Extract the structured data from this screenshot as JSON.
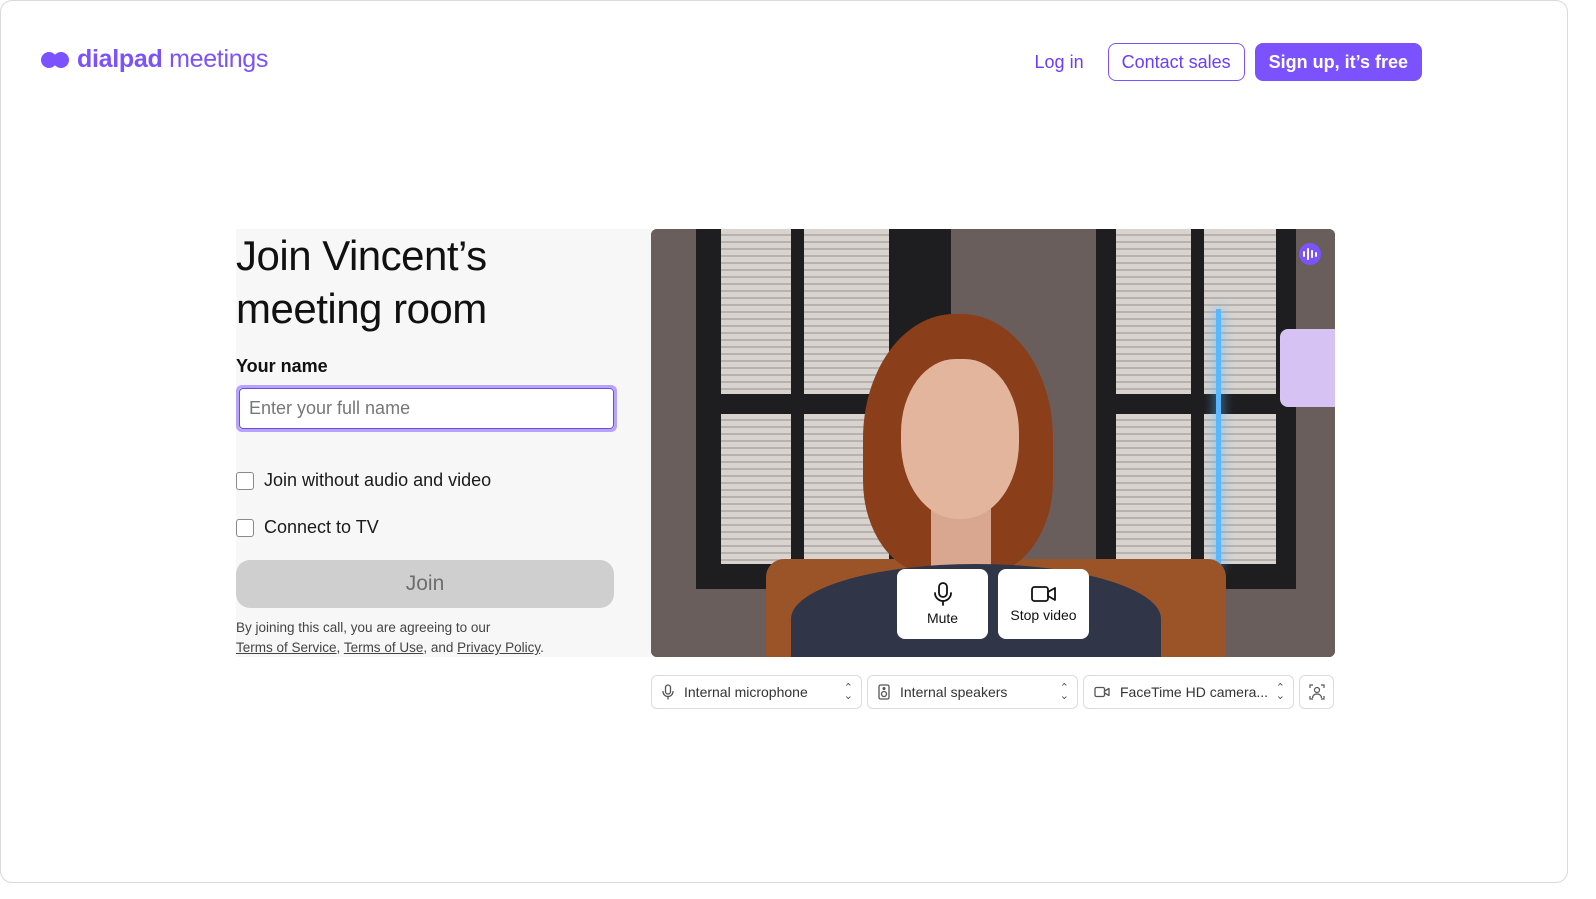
{
  "brand": {
    "name_bold": "dialpad",
    "name_light": " meetings",
    "accent": "#7c52ff"
  },
  "nav": {
    "login": "Log in",
    "contact": "Contact sales",
    "signup": "Sign up, it’s free"
  },
  "join_form": {
    "title_line1": "Join Vincent’s",
    "title_line2": "meeting room",
    "name_label": "Your name",
    "name_placeholder": "Enter your full name",
    "name_value": "",
    "option_no_av": "Join without audio and video",
    "option_no_av_checked": false,
    "option_tv": "Connect to TV",
    "option_tv_checked": false,
    "join_button": "Join",
    "legal_prefix": "By joining this call, you are agreeing to our",
    "legal_tos": "Terms of Service",
    "legal_sep1": ",",
    "legal_tou": "Terms of Use",
    "legal_sep2": ", and",
    "legal_privacy": "Privacy Policy",
    "legal_end": "."
  },
  "preview": {
    "mute_label": "Mute",
    "stop_video_label": "Stop video"
  },
  "devices": {
    "microphone": "Internal microphone",
    "speakers": "Internal speakers",
    "camera": "FaceTime HD camera..."
  }
}
